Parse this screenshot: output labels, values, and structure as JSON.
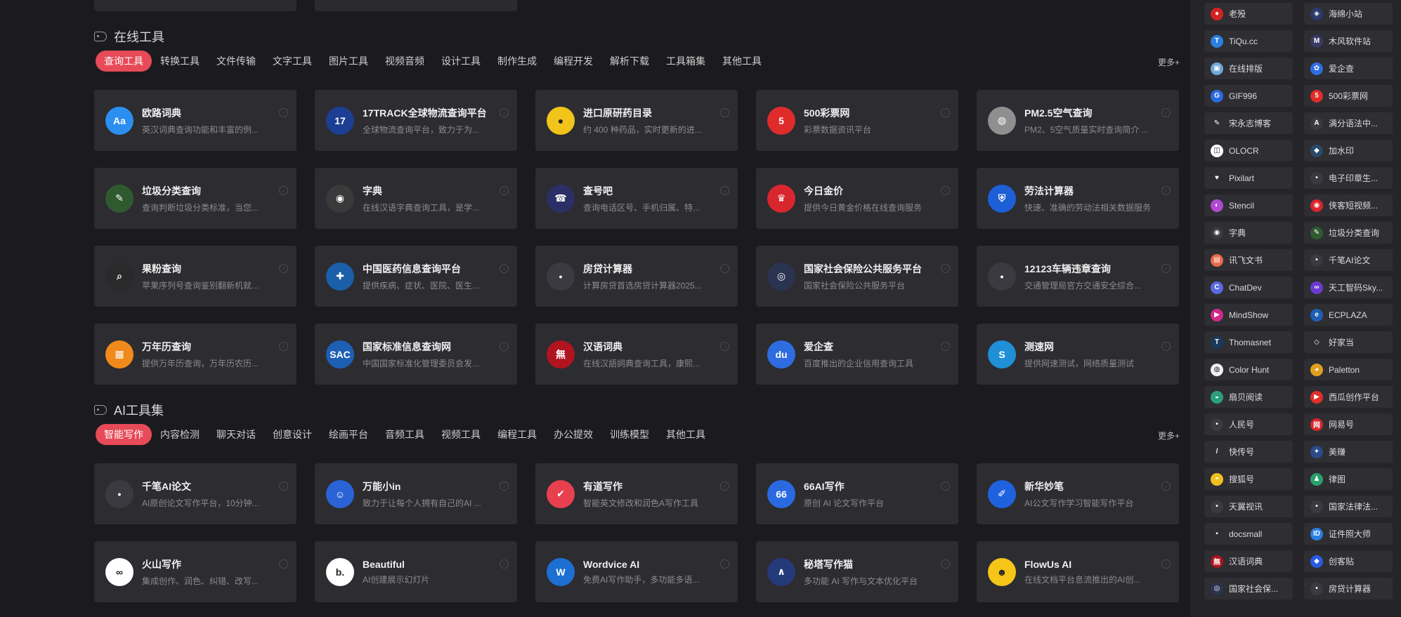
{
  "online_tools": {
    "title": "在线工具",
    "more": "更多+",
    "tabs": [
      "查询工具",
      "转换工具",
      "文件传输",
      "文字工具",
      "图片工具",
      "视频音频",
      "设计工具",
      "制作生成",
      "编程开发",
      "解析下载",
      "工具箱集",
      "其他工具"
    ],
    "cards": [
      {
        "title": "欧路词典",
        "desc": "英汉词典查询功能和丰富的例...",
        "icon": "dictionary-icon",
        "color": "#2a8ff0",
        "glyph": "Aa"
      },
      {
        "title": "17TRACK全球物流查询平台",
        "desc": "全球物流查询平台，致力于为...",
        "icon": "track-17-icon",
        "color": "#1d3f93",
        "glyph": "17"
      },
      {
        "title": "进口原研药目录",
        "desc": "约 400 种药品，实时更新的进...",
        "icon": "pill-icon",
        "color": "#f0c419",
        "glyph": "●"
      },
      {
        "title": "500彩票网",
        "desc": "彩票数据资讯平台",
        "icon": "lottery-500-icon",
        "color": "#e02b2b",
        "glyph": "5"
      },
      {
        "title": "PM2.5空气查询",
        "desc": "PM2、5空气质量实时查询简介 ...",
        "icon": "globe-icon",
        "color": "#8f8f8f",
        "glyph": "◍"
      },
      {
        "title": "垃圾分类查询",
        "desc": "查询判断垃圾分类标准，当您...",
        "icon": "leaf-icon",
        "color": "#2f5a2f",
        "glyph": "✎"
      },
      {
        "title": "字典",
        "desc": "在线汉语字典查询工具，是学...",
        "icon": "owl-icon",
        "color": "#3a3a3a",
        "glyph": "◉"
      },
      {
        "title": "查号吧",
        "desc": "查询电话区号、手机归属、特...",
        "icon": "phone-icon",
        "color": "#2a2f66",
        "glyph": "☎"
      },
      {
        "title": "今日金价",
        "desc": "提供今日黄金价格在线查询服务",
        "icon": "gold-price-icon",
        "color": "#d8262e",
        "glyph": "♛"
      },
      {
        "title": "劳法计算器",
        "desc": "快速、准确的劳动法相关数据服务",
        "icon": "shield-calc-icon",
        "color": "#1d5fd6",
        "glyph": "⛨"
      },
      {
        "title": "果粉查询",
        "desc": "苹果序列号查询鉴别翻新机就...",
        "icon": "magnifier-icon",
        "color": "#2a2a2a",
        "glyph": "⌕"
      },
      {
        "title": "中国医药信息查询平台",
        "desc": "提供疾病、症状、医院、医生...",
        "icon": "medical-icon",
        "color": "#1a5fa8",
        "glyph": "✚"
      },
      {
        "title": "房贷计算器",
        "desc": "计算房贷首选房贷计算器2025...",
        "icon": "mortgage-icon",
        "color": "#3a3a40",
        "glyph": "•"
      },
      {
        "title": "国家社会保险公共服务平台",
        "desc": "国家社会保险公共服务平台",
        "icon": "social-insurance-icon",
        "color": "#2a3350",
        "glyph": "◎"
      },
      {
        "title": "12123车辆违章查询",
        "desc": "交通管理局官方交通安全综合...",
        "icon": "traffic-icon",
        "color": "#3a3a40",
        "glyph": "•"
      },
      {
        "title": "万年历查询",
        "desc": "提供万年历查询，万年历农历...",
        "icon": "calendar-icon",
        "color": "#f08a1c",
        "glyph": "▦"
      },
      {
        "title": "国家标准信息查询网",
        "desc": "中国国家标准化管理委员会发...",
        "icon": "sac-icon",
        "color": "#1e5fb4",
        "glyph": "SAC"
      },
      {
        "title": "汉语词典",
        "desc": "在线汉語詞典查询工具，康熙...",
        "icon": "hanyu-icon",
        "color": "#b0141e",
        "glyph": "無"
      },
      {
        "title": "爱企查",
        "desc": "百度推出的企业信用查询工具",
        "icon": "baidu-paw-icon",
        "color": "#2f6ce0",
        "glyph": "du"
      },
      {
        "title": "测速网",
        "desc": "提供网速测试，网络质量测试",
        "icon": "speedtest-icon",
        "color": "#1f8fd6",
        "glyph": "S"
      }
    ]
  },
  "ai_tools": {
    "title": "AI工具集",
    "more": "更多+",
    "tabs": [
      "智能写作",
      "内容检测",
      "聊天对话",
      "创意设计",
      "绘画平台",
      "音频工具",
      "视频工具",
      "编程工具",
      "办公提效",
      "训练模型",
      "其他工具"
    ],
    "cards": [
      {
        "title": "千笔AI论文",
        "desc": "AI原创论文写作平台，10分钟...",
        "icon": "qianbi-icon",
        "color": "#3a3a40",
        "glyph": "•"
      },
      {
        "title": "万能小in",
        "desc": "致力于让每个人拥有自己的AI ...",
        "icon": "robot-icon",
        "color": "#2a63d6",
        "glyph": "☺"
      },
      {
        "title": "有道写作",
        "desc": "智能英文修改和润色A写作工具",
        "icon": "youdao-icon",
        "color": "#e8404f",
        "glyph": "✔"
      },
      {
        "title": "66AI写作",
        "desc": "原创 AI 论文写作平台",
        "icon": "ai66-icon",
        "color": "#2a6ae0",
        "glyph": "66"
      },
      {
        "title": "新华妙笔",
        "desc": "AI公文写作学习智能写作平台",
        "icon": "brush-icon",
        "color": "#1f62e0",
        "glyph": "✐"
      },
      {
        "title": "火山写作",
        "desc": "集成创作、润色、纠错、改写...",
        "icon": "volcano-icon",
        "color": "#ffffff",
        "glyph": "∞"
      },
      {
        "title": "Beautiful",
        "desc": "AI创建展示幻灯片",
        "icon": "beautiful-icon",
        "color": "#ffffff",
        "glyph": "b."
      },
      {
        "title": "Wordvice AI",
        "desc": "免费AI写作助手，多功能多语...",
        "icon": "wordvice-icon",
        "color": "#1d6fd1",
        "glyph": "W"
      },
      {
        "title": "秘塔写作猫",
        "desc": "多功能 AI 写作与文本优化平台",
        "icon": "metaso-icon",
        "color": "#243a7a",
        "glyph": "∧"
      },
      {
        "title": "FlowUs AI",
        "desc": "在线文档平台息流推出的AI创...",
        "icon": "smiley-icon",
        "color": "#f5c518",
        "glyph": "☻"
      }
    ]
  },
  "sidebar": {
    "items": [
      {
        "label": "老殁",
        "icon": "laomo-icon",
        "color": "#d32222",
        "glyph": "●"
      },
      {
        "label": "海绵小站",
        "icon": "sponge-icon",
        "color": "#2a3a6a",
        "glyph": "◈"
      },
      {
        "label": "TiQu.cc",
        "icon": "tiqu-icon",
        "color": "#2a7fe0",
        "glyph": "T"
      },
      {
        "label": "木风软件站",
        "icon": "mufeng-icon",
        "color": "#3a3a66",
        "glyph": "M"
      },
      {
        "label": "在线排版",
        "icon": "layout-icon",
        "color": "#6fa8d8",
        "glyph": "▣"
      },
      {
        "label": "爱企查",
        "icon": "baidu-paw-icon",
        "color": "#2f6ce0",
        "glyph": "✿"
      },
      {
        "label": "GIF996",
        "icon": "gif996-icon",
        "color": "#2a6ae0",
        "glyph": "G"
      },
      {
        "label": "500彩票网",
        "icon": "lottery-500-icon",
        "color": "#e02b2b",
        "glyph": "5"
      },
      {
        "label": "宋永志博客",
        "icon": "blog-icon",
        "color": "#2e2e33",
        "glyph": "✎"
      },
      {
        "label": "满分语法中...",
        "icon": "grammar-icon",
        "color": "#3a3a40",
        "glyph": "A"
      },
      {
        "label": "OLOCR",
        "icon": "ocr-icon",
        "color": "#ffffff",
        "glyph": "◫"
      },
      {
        "label": "加水印",
        "icon": "watermark-icon",
        "color": "#2a4a6a",
        "glyph": "◆"
      },
      {
        "label": "Pixilart",
        "icon": "heart-icon",
        "color": "#2e2e33",
        "glyph": "♥"
      },
      {
        "label": "电子印章生...",
        "icon": "seal-icon",
        "color": "#3a3a40",
        "glyph": "•"
      },
      {
        "label": "Stencil",
        "icon": "stencil-icon",
        "color": "#b04ad0",
        "glyph": "◐"
      },
      {
        "label": "侠客短视频...",
        "icon": "xiake-icon",
        "color": "#d8262e",
        "glyph": "◉"
      },
      {
        "label": "字典",
        "icon": "owl-icon",
        "color": "#3a3a3a",
        "glyph": "◉"
      },
      {
        "label": "垃圾分类查询",
        "icon": "leaf-icon",
        "color": "#2f5a2f",
        "glyph": "✎"
      },
      {
        "label": "讯飞文书",
        "icon": "xunfei-icon",
        "color": "#e86a4a",
        "glyph": "▤"
      },
      {
        "label": "千笔AI论文",
        "icon": "qianbi-icon",
        "color": "#3a3a40",
        "glyph": "•"
      },
      {
        "label": "ChatDev",
        "icon": "chatdev-icon",
        "color": "#5a6ae0",
        "glyph": "C"
      },
      {
        "label": "天工智码Sky...",
        "icon": "tiangong-icon",
        "color": "#6a3ad0",
        "glyph": "∞"
      },
      {
        "label": "MindShow",
        "icon": "mindshow-icon",
        "color": "#d02a8a",
        "glyph": "▶"
      },
      {
        "label": "ECPLAZA",
        "icon": "ecplaza-icon",
        "color": "#1e5fb4",
        "glyph": "e"
      },
      {
        "label": "Thomasnet",
        "icon": "thomasnet-icon",
        "color": "#1a3a5a",
        "glyph": "T"
      },
      {
        "label": "好家当",
        "icon": "haojiadang-icon",
        "color": "#2e2e33",
        "glyph": "◇"
      },
      {
        "label": "Color Hunt",
        "icon": "colorhunt-icon",
        "color": "#f0f0f0",
        "glyph": "◍"
      },
      {
        "label": "Paletton",
        "icon": "paletton-icon",
        "color": "#e0a020",
        "glyph": "◕"
      },
      {
        "label": "扇贝阅读",
        "icon": "shanbay-icon",
        "color": "#2aa07a",
        "glyph": "◒"
      },
      {
        "label": "西瓜创作平台",
        "icon": "xigua-icon",
        "color": "#e0302a",
        "glyph": "▶"
      },
      {
        "label": "人民号",
        "icon": "renmin-icon",
        "color": "#3a3a40",
        "glyph": "•"
      },
      {
        "label": "网易号",
        "icon": "netease-icon",
        "color": "#d8262e",
        "glyph": "网"
      },
      {
        "label": "快传号",
        "icon": "kuaichuan-icon",
        "color": "#2e2e33",
        "glyph": "/"
      },
      {
        "label": "美赚",
        "icon": "meizhuan-icon",
        "color": "#2a4a8a",
        "glyph": "✦"
      },
      {
        "label": "搜狐号",
        "icon": "sohu-icon",
        "color": "#f0c020",
        "glyph": "◓"
      },
      {
        "label": "律图",
        "icon": "lvtu-icon",
        "color": "#2aa06a",
        "glyph": "♟"
      },
      {
        "label": "天翼视讯",
        "icon": "tianyi-icon",
        "color": "#3a3a40",
        "glyph": "•"
      },
      {
        "label": "国家法律法...",
        "icon": "law-icon",
        "color": "#3a3a40",
        "glyph": "•"
      },
      {
        "label": "docsmall",
        "icon": "docsmall-icon",
        "color": "#2e2e33",
        "glyph": "▪"
      },
      {
        "label": "证件照大师",
        "icon": "idphoto-icon",
        "color": "#2a7fe0",
        "glyph": "ID"
      },
      {
        "label": "汉语词典",
        "icon": "hanyu-icon",
        "color": "#b0141e",
        "glyph": "無"
      },
      {
        "label": "创客贴",
        "icon": "chuangketie-icon",
        "color": "#2a5ae0",
        "glyph": "◆"
      },
      {
        "label": "国家社会保...",
        "icon": "social-insurance-icon",
        "color": "#2a3350",
        "glyph": "◎"
      },
      {
        "label": "房贷计算器",
        "icon": "mortgage-icon",
        "color": "#3a3a40",
        "glyph": "•"
      }
    ]
  }
}
